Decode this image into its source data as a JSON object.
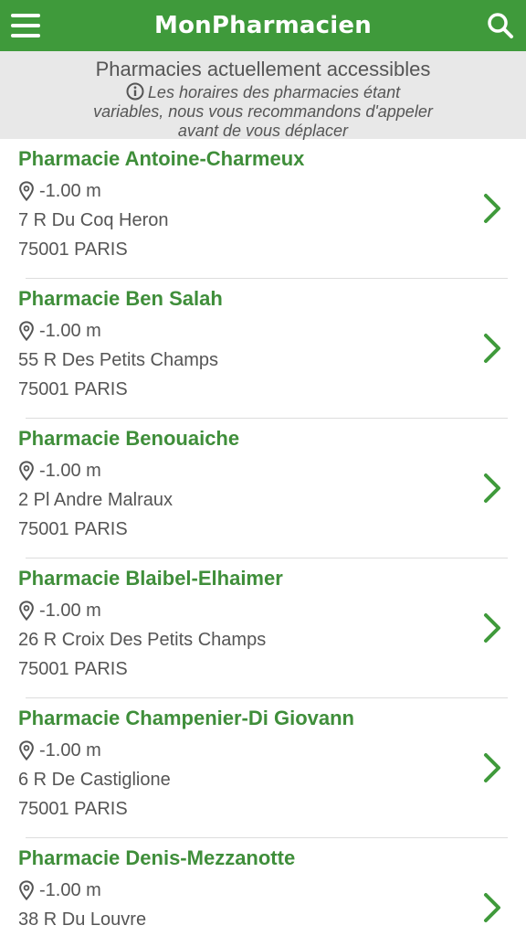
{
  "header": {
    "title": "MonPharmacien",
    "menu_icon": "hamburger-icon",
    "search_icon": "search-icon",
    "accent_color": "#3f9a3b"
  },
  "notice": {
    "title": "Pharmacies actuellement accessibles",
    "text": "Les horaires des pharmacies étant variables, nous vous recommandons d'appeler avant de vous déplacer",
    "icon": "info-icon"
  },
  "pharmacies": [
    {
      "name": "Pharmacie Antoine-Charmeux",
      "distance": "-1.00 m",
      "address": "7 R Du Coq Heron",
      "city": "75001 PARIS"
    },
    {
      "name": "Pharmacie Ben Salah",
      "distance": "-1.00 m",
      "address": "55 R Des Petits Champs",
      "city": "75001 PARIS"
    },
    {
      "name": "Pharmacie Benouaiche",
      "distance": "-1.00 m",
      "address": "2 Pl Andre Malraux",
      "city": "75001 PARIS"
    },
    {
      "name": "Pharmacie Blaibel-Elhaimer",
      "distance": "-1.00 m",
      "address": "26 R Croix Des Petits Champs",
      "city": "75001 PARIS"
    },
    {
      "name": "Pharmacie Champenier-Di Giovann",
      "distance": "-1.00 m",
      "address": "6 R De Castiglione",
      "city": "75001 PARIS"
    },
    {
      "name": "Pharmacie Denis-Mezzanotte",
      "distance": "-1.00 m",
      "address": "38 R Du Louvre",
      "city": ""
    }
  ]
}
